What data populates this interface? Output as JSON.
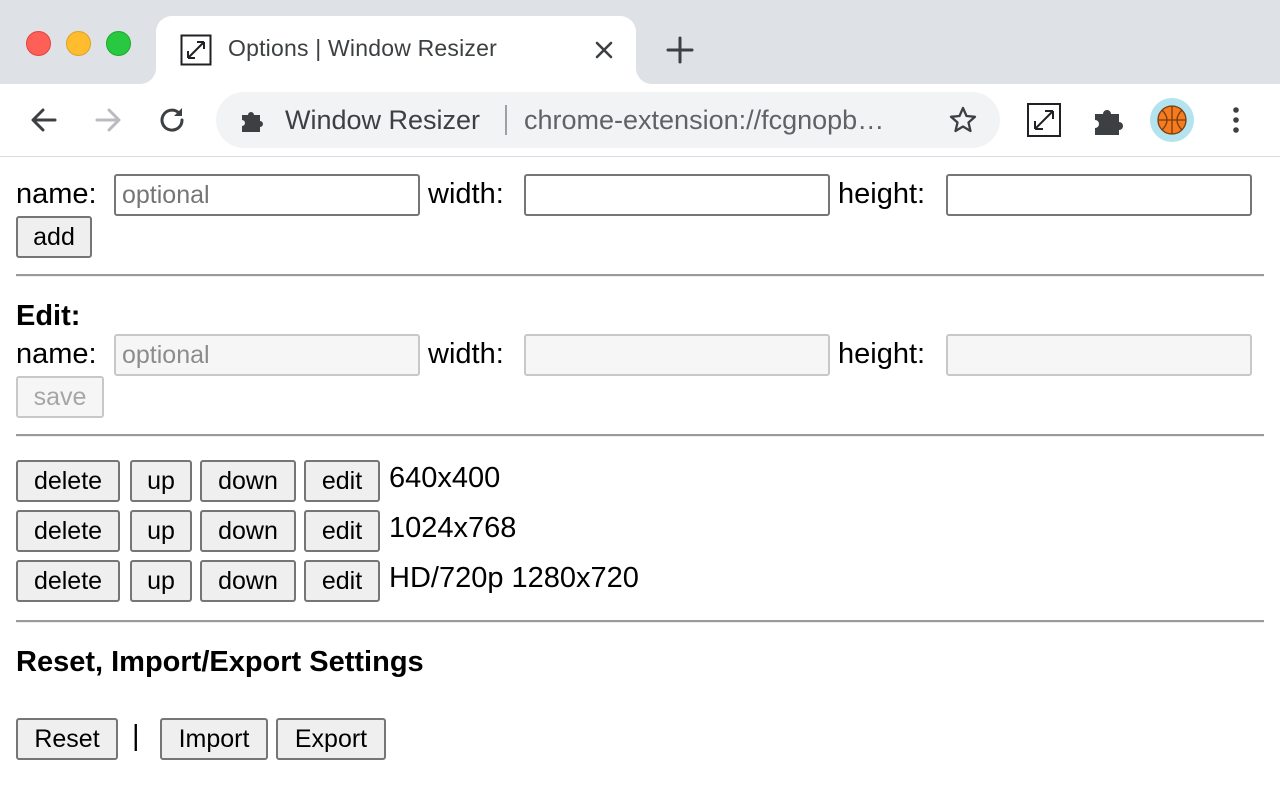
{
  "browser": {
    "tab": {
      "title": "Options | Window Resizer",
      "favicon": "resize-arrows-icon"
    },
    "omnibox": {
      "extension_name": "Window Resizer",
      "url": "chrome-extension://fcgnopb…"
    },
    "colors": {
      "tabstrip": "#dee1e6",
      "avatar_bg": "#b3e3ee",
      "basketball": "#f47b20"
    }
  },
  "add_form": {
    "name_label": "name:",
    "name_placeholder": "optional",
    "width_label": "width:",
    "height_label": "height:",
    "add_label": "add"
  },
  "edit_form": {
    "heading": "Edit:",
    "name_label": "name:",
    "name_placeholder": "optional",
    "width_label": "width:",
    "height_label": "height:",
    "save_label": "save"
  },
  "preset_actions": {
    "delete": "delete",
    "up": "up",
    "down": "down",
    "edit": "edit"
  },
  "presets": [
    {
      "label": "640x400"
    },
    {
      "label": "1024x768"
    },
    {
      "label": "HD/720p 1280x720"
    }
  ],
  "settings": {
    "heading": "Reset, Import/Export Settings",
    "reset_label": "Reset",
    "separator": "|",
    "import_label": "Import",
    "export_label": "Export"
  }
}
